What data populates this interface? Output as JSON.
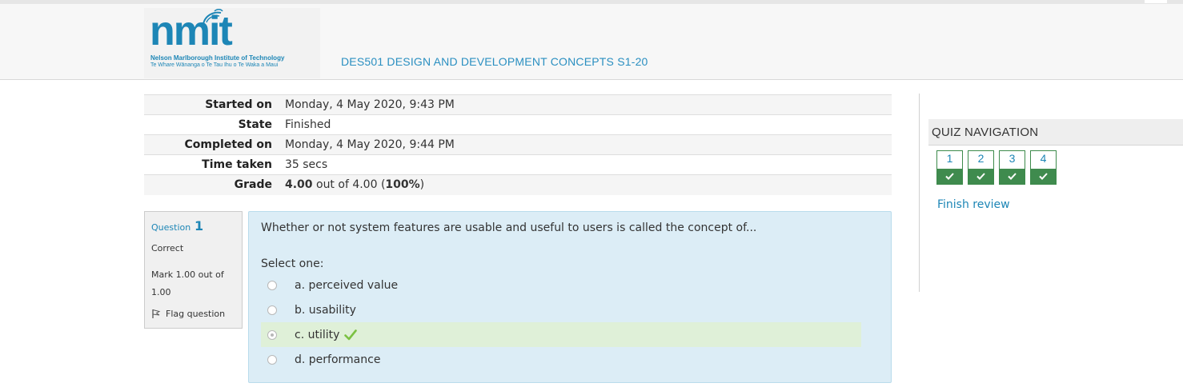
{
  "header": {
    "logo_text": "nmit",
    "logo_sub1": "Nelson Marlborough Institute of Technology",
    "logo_sub2": "Te Whare Wānanga o Te Tau Ihu o Te Waka a Maui",
    "course_title": "DES501 DESIGN AND DEVELOPMENT CONCEPTS S1-20"
  },
  "summary": {
    "rows": [
      {
        "label": "Started on",
        "value": "Monday, 4 May 2020, 9:43 PM"
      },
      {
        "label": "State",
        "value": "Finished"
      },
      {
        "label": "Completed on",
        "value": "Monday, 4 May 2020, 9:44 PM"
      },
      {
        "label": "Time taken",
        "value": "35 secs"
      }
    ],
    "grade": {
      "label": "Grade",
      "score": "4.00",
      "mid": " out of 4.00 (",
      "percent": "100%",
      "end": ")"
    }
  },
  "question": {
    "label": "Question",
    "number": "1",
    "state": "Correct",
    "mark": "Mark 1.00 out of 1.00",
    "flag": "Flag question",
    "text": "Whether or not system features are usable and useful to users is called the concept of...",
    "prompt": "Select one:",
    "answers": [
      {
        "label": "a. perceived value",
        "selected": false,
        "correct": false
      },
      {
        "label": "b. usability",
        "selected": false,
        "correct": false
      },
      {
        "label": "c. utility",
        "selected": true,
        "correct": true
      },
      {
        "label": "d. performance",
        "selected": false,
        "correct": false
      }
    ]
  },
  "quiz_nav": {
    "title": "QUIZ NAVIGATION",
    "buttons": [
      "1",
      "2",
      "3",
      "4"
    ],
    "finish_review": "Finish review"
  },
  "colors": {
    "accent": "#1d86b6",
    "correct_bg": "#dff0d8",
    "nav_green": "#3f8b4e",
    "question_bg": "#dcedf6"
  }
}
